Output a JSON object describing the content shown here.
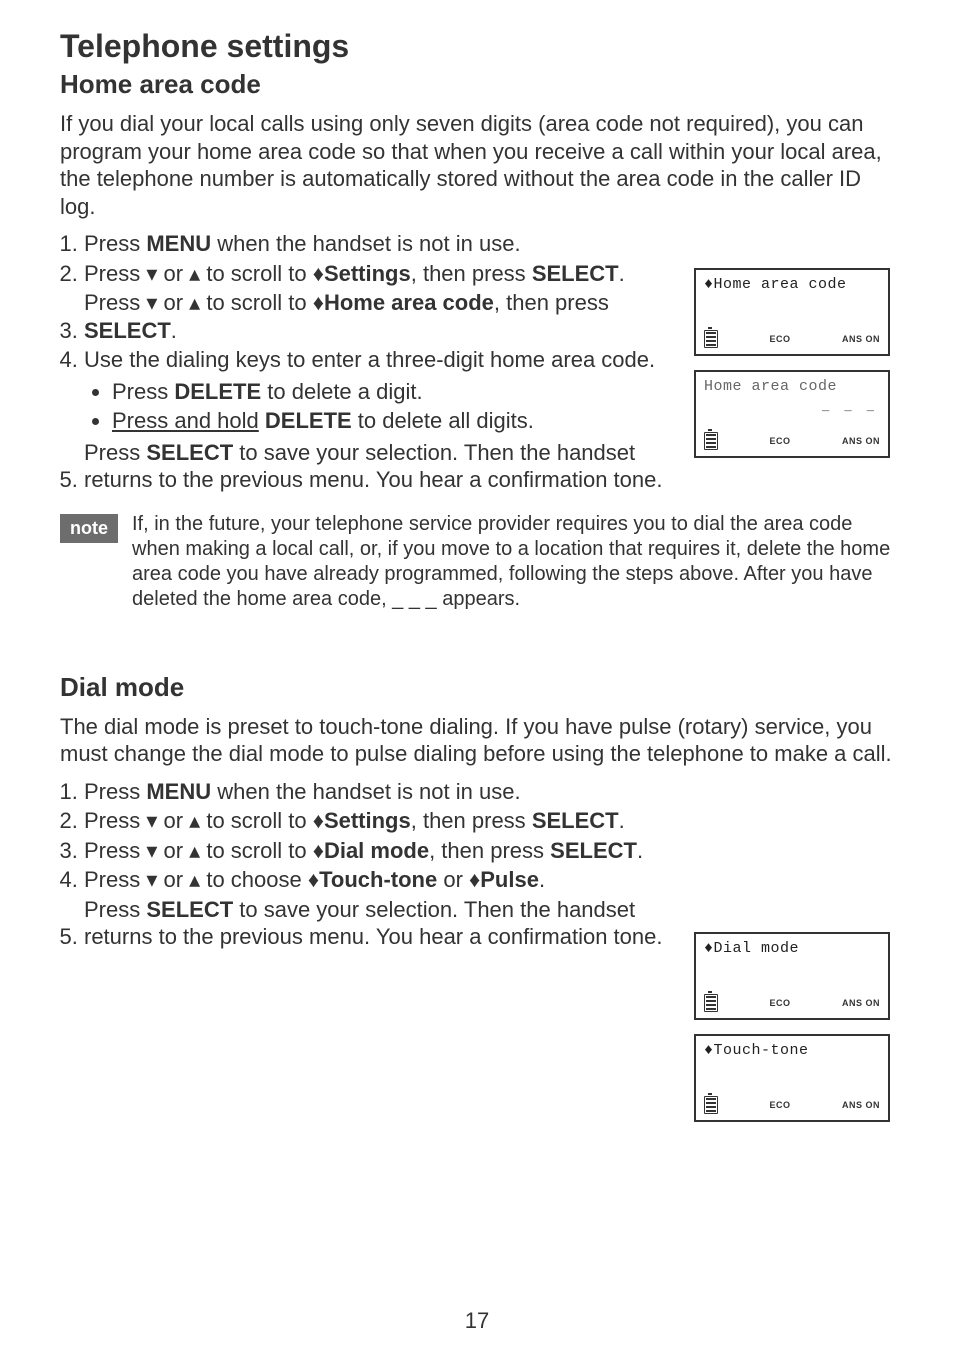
{
  "title": "Telephone settings",
  "section1": {
    "heading": "Home area code",
    "intro": "If you dial your local calls using only seven digits (area code not required), you can program your home area code so that when you receive a call within your local area, the telephone number is automatically stored without the area code in the caller ID log.",
    "steps": {
      "s1_a": "Press ",
      "s1_b": "MENU",
      "s1_c": " when the handset is not in use.",
      "s2_a": "Press ▾ or ▴ to scroll to ",
      "s2_b": "Settings",
      "s2_c": ", then press ",
      "s2_d": "SELECT",
      "s2_e": ".",
      "s3_a": "Press ▾ or ▴ to scroll to ",
      "s3_b": "Home area code",
      "s3_c": ", then press ",
      "s3_d": "SELECT",
      "s3_e": ".",
      "s4_a": "Use the dialing keys to enter a three-digit home area code.",
      "s4_sub1_a": "Press ",
      "s4_sub1_b": "DELETE",
      "s4_sub1_c": " to delete a digit.",
      "s4_sub2_a": "Press and hold",
      "s4_sub2_b": " ",
      "s4_sub2_c": "DELETE",
      "s4_sub2_d": " to delete all digits.",
      "s5_a": "Press ",
      "s5_b": "SELECT",
      "s5_c": " to save your selection. Then the handset returns to the previous menu. You hear a confirmation tone."
    },
    "note_label": "note",
    "note": "If, in the future, your telephone service provider requires you to dial the area code when making a local call, or, if you move to a location that requires it, delete the home area code you have already programmed, following the steps above. After you have deleted the home area code, _ _ _ appears."
  },
  "section2": {
    "heading": "Dial mode",
    "intro": "The dial mode is preset to touch-tone dialing. If you have pulse (rotary) service, you must change the dial mode to pulse dialing before using the telephone to make a call.",
    "steps": {
      "s1_a": "Press ",
      "s1_b": "MENU",
      "s1_c": " when the handset is not in use.",
      "s2_a": "Press ▾ or ▴ to scroll to ",
      "s2_b": "Settings",
      "s2_c": ", then press ",
      "s2_d": "SELECT",
      "s2_e": ".",
      "s3_a": "Press ▾ or ▴ to scroll to ",
      "s3_b": "Dial mode",
      "s3_c": ", then press ",
      "s3_d": "SELECT",
      "s3_e": ".",
      "s4_a": "Press ▾ or ▴ to choose ",
      "s4_b": "Touch-tone",
      "s4_c": " or ",
      "s4_d": "Pulse",
      "s4_e": ".",
      "s5_a": "Press ",
      "s5_b": "SELECT",
      "s5_c": " to save your selection. Then the handset returns to the previous menu. You hear a confirmation tone."
    }
  },
  "lcd": {
    "arrow": "♦",
    "home_area_code": "Home area code",
    "dashes": "_ _ _",
    "dial_mode": "Dial mode",
    "touch_tone": "Touch-tone",
    "eco": "ECO",
    "ans": "ANS ON"
  },
  "page_number": "17",
  "diamond": "♦"
}
